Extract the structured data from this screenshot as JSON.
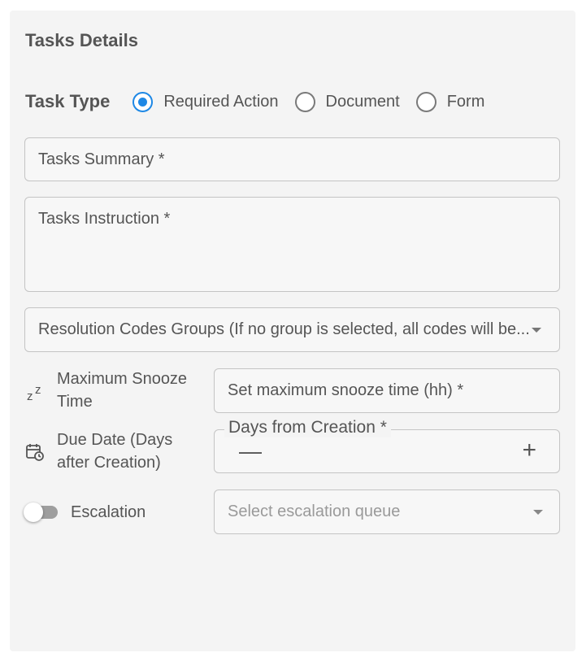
{
  "panel": {
    "title": "Tasks Details"
  },
  "task_type": {
    "label": "Task Type",
    "options": [
      {
        "label": "Required Action",
        "selected": true
      },
      {
        "label": "Document",
        "selected": false
      },
      {
        "label": "Form",
        "selected": false
      }
    ]
  },
  "fields": {
    "summary_placeholder": "Tasks Summary *",
    "instruction_placeholder": "Tasks Instruction *",
    "resolution_placeholder": "Resolution Codes Groups (If no group is selected, all codes will be..."
  },
  "snooze": {
    "icon": "snooze-icon",
    "label": "Maximum Snooze Time",
    "placeholder": "Set maximum snooze time (hh) *"
  },
  "due_date": {
    "icon": "calendar-icon",
    "label": "Due Date (Days after Creation)",
    "input_label": "Days from Creation *",
    "minus": "—",
    "plus": "+"
  },
  "escalation": {
    "label": "Escalation",
    "toggle_on": false,
    "placeholder": "Select escalation queue"
  },
  "colors": {
    "accent": "#1e88e5",
    "panel_bg": "#f4f4f4",
    "border": "#c4c4c4"
  }
}
